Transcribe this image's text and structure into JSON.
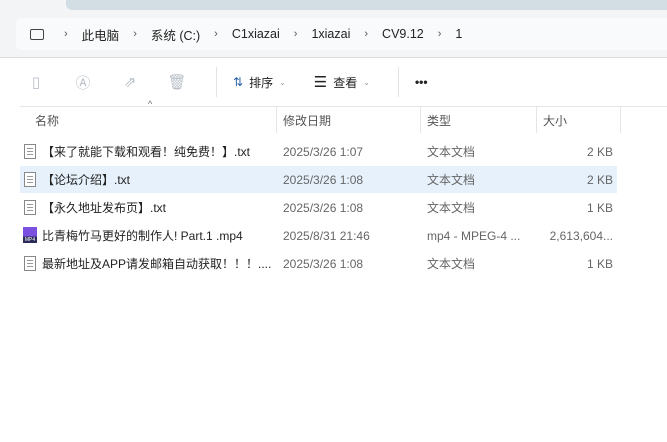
{
  "breadcrumb": [
    "此电脑",
    "系统 (C:)",
    "C1xiazai",
    "1xiazai",
    "CV9.12",
    "1"
  ],
  "toolbar": {
    "sort": "排序",
    "view": "查看",
    "more": "•••"
  },
  "columns": {
    "name": "名称",
    "date": "修改日期",
    "type": "类型",
    "size": "大小"
  },
  "files": [
    {
      "name": "【来了就能下载和观看！纯免费！】.txt",
      "date": "2025/3/26 1:07",
      "type": "文本文档",
      "size": "2 KB",
      "icon": "text-file-icon"
    },
    {
      "name": "【论坛介绍】.txt",
      "date": "2025/3/26 1:08",
      "type": "文本文档",
      "size": "2 KB",
      "icon": "text-file-icon"
    },
    {
      "name": "【永久地址发布页】.txt",
      "date": "2025/3/26 1:08",
      "type": "文本文档",
      "size": "1 KB",
      "icon": "text-file-icon"
    },
    {
      "name": "比青梅竹马更好的制作人! Part.1 .mp4",
      "date": "2025/8/31 21:46",
      "type": "mp4 - MPEG-4 ...",
      "size": "2,613,604...",
      "icon": "mp4-file-icon"
    },
    {
      "name": "最新地址及APP请发邮箱自动获取！！！....",
      "date": "2025/3/26 1:08",
      "type": "文本文档",
      "size": "1 KB",
      "icon": "text-file-icon"
    }
  ],
  "colors": {
    "selected": "#e6f1fb"
  }
}
